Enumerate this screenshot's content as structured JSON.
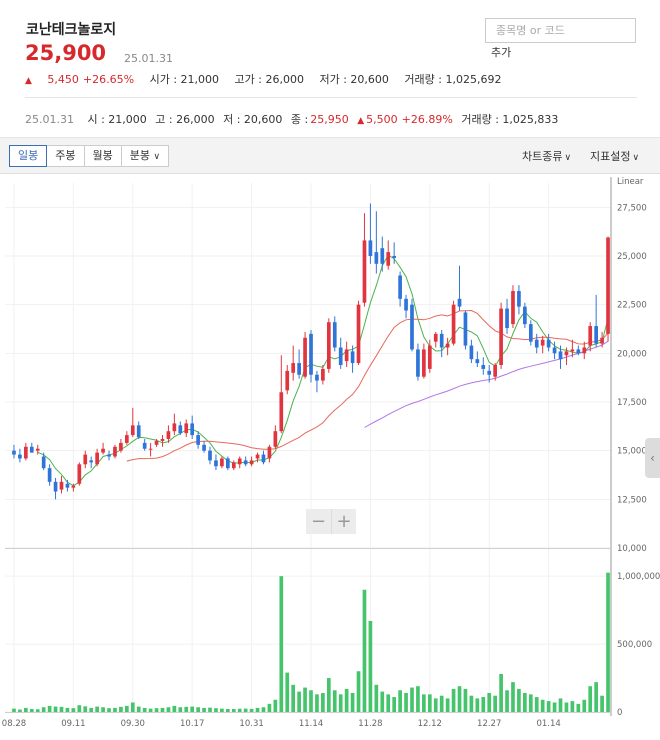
{
  "stock": {
    "name": "코난테크놀로지",
    "price": "25,900",
    "date": "25.01.31",
    "change_arrow": "▲",
    "change": "5,450",
    "change_pct": "+26.65%",
    "open_label": "시가 : 21,000",
    "high_label": "고가 : 26,000",
    "low_label": "저가 : 20,600",
    "volume_label": "거래량 : 1,025,692"
  },
  "search": {
    "placeholder": "종목명 or 코드",
    "add_label": "추가"
  },
  "ohlc_bar": {
    "date": "25.01.31",
    "open": "시 : 21,000",
    "high": "고 : 26,000",
    "low": "저 : 20,600",
    "close_label": "종 :",
    "close": "25,950",
    "change_arrow": "▲",
    "change": "5,500",
    "change_pct": "+26.89%",
    "volume": "거래량 : 1,025,833"
  },
  "toolbar": {
    "tabs": [
      "일봉",
      "주봉",
      "월봉",
      "분봉"
    ],
    "minute_chevron": "∨",
    "chart_type": "차트종류",
    "indicator": "지표설정",
    "chevron": "∨"
  },
  "zoom": {
    "minus": "−",
    "plus": "+"
  },
  "side_handle": "‹",
  "colors": {
    "up": "#e0353f",
    "down": "#2f74d8",
    "ma5": "#4cb34c",
    "ma20": "#e8695b",
    "ma60": "#b277e8",
    "ma120": "#f0a25a",
    "volume": "#46c46c"
  },
  "chart_data": {
    "type": "candlestick",
    "price_scale_label": "Linear",
    "ylim": [
      10000,
      28750
    ],
    "y_ticks": [
      "27,500",
      "25,000",
      "22,500",
      "20,000",
      "17,500",
      "15,000",
      "12,500",
      "10,000"
    ],
    "y_tick_values": [
      27500,
      25000,
      22500,
      20000,
      17500,
      15000,
      12500,
      10000
    ],
    "x_ticks": [
      "08.28",
      "09.11",
      "09.30",
      "10.17",
      "10.31",
      "11.14",
      "11.28",
      "12.12",
      "12.27",
      "01.14"
    ],
    "x_tick_index": [
      0,
      10,
      20,
      30,
      40,
      50,
      60,
      70,
      80,
      90
    ],
    "volume_ticks": [
      "1,000,000",
      "500,000",
      "0"
    ],
    "volume_tick_values": [
      1000000,
      500000,
      0
    ],
    "volume_max": 1200000,
    "candles": [
      {
        "o": 15000,
        "h": 15300,
        "l": 14600,
        "c": 14800,
        "v": 25000
      },
      {
        "o": 14800,
        "h": 15100,
        "l": 14400,
        "c": 14600,
        "v": 18000
      },
      {
        "o": 14600,
        "h": 15400,
        "l": 14500,
        "c": 15200,
        "v": 30000
      },
      {
        "o": 15200,
        "h": 15400,
        "l": 14900,
        "c": 14900,
        "v": 22000
      },
      {
        "o": 15000,
        "h": 15300,
        "l": 14800,
        "c": 15100,
        "v": 20000
      },
      {
        "o": 14700,
        "h": 14900,
        "l": 14000,
        "c": 14100,
        "v": 35000
      },
      {
        "o": 14100,
        "h": 14300,
        "l": 13200,
        "c": 13400,
        "v": 45000
      },
      {
        "o": 13400,
        "h": 13600,
        "l": 12500,
        "c": 12900,
        "v": 40000
      },
      {
        "o": 13000,
        "h": 13700,
        "l": 12800,
        "c": 13400,
        "v": 38000
      },
      {
        "o": 13300,
        "h": 13500,
        "l": 12900,
        "c": 13100,
        "v": 30000
      },
      {
        "o": 13100,
        "h": 13300,
        "l": 12900,
        "c": 13200,
        "v": 28000
      },
      {
        "o": 13300,
        "h": 14400,
        "l": 13200,
        "c": 14300,
        "v": 50000
      },
      {
        "o": 14300,
        "h": 15000,
        "l": 14100,
        "c": 14800,
        "v": 42000
      },
      {
        "o": 14500,
        "h": 14700,
        "l": 14100,
        "c": 14400,
        "v": 30000
      },
      {
        "o": 14300,
        "h": 15100,
        "l": 14200,
        "c": 14900,
        "v": 40000
      },
      {
        "o": 14900,
        "h": 15400,
        "l": 14800,
        "c": 15100,
        "v": 35000
      },
      {
        "o": 14800,
        "h": 15000,
        "l": 14500,
        "c": 14700,
        "v": 28000
      },
      {
        "o": 14700,
        "h": 15300,
        "l": 14600,
        "c": 15200,
        "v": 30000
      },
      {
        "o": 15000,
        "h": 15600,
        "l": 14900,
        "c": 15400,
        "v": 38000
      },
      {
        "o": 15400,
        "h": 16000,
        "l": 15300,
        "c": 15800,
        "v": 45000
      },
      {
        "o": 15800,
        "h": 17200,
        "l": 15700,
        "c": 16300,
        "v": 70000
      },
      {
        "o": 16300,
        "h": 16500,
        "l": 15600,
        "c": 15700,
        "v": 40000
      },
      {
        "o": 15400,
        "h": 15600,
        "l": 15000,
        "c": 15100,
        "v": 30000
      },
      {
        "o": 15100,
        "h": 15400,
        "l": 14700,
        "c": 15100,
        "v": 25000
      },
      {
        "o": 15300,
        "h": 15600,
        "l": 15200,
        "c": 15500,
        "v": 28000
      },
      {
        "o": 15500,
        "h": 15800,
        "l": 15200,
        "c": 15600,
        "v": 30000
      },
      {
        "o": 15600,
        "h": 16300,
        "l": 15400,
        "c": 16000,
        "v": 35000
      },
      {
        "o": 16000,
        "h": 16900,
        "l": 15800,
        "c": 16400,
        "v": 45000
      },
      {
        "o": 16300,
        "h": 16500,
        "l": 15800,
        "c": 15900,
        "v": 35000
      },
      {
        "o": 15900,
        "h": 16600,
        "l": 15700,
        "c": 16400,
        "v": 38000
      },
      {
        "o": 16400,
        "h": 16800,
        "l": 15600,
        "c": 15800,
        "v": 40000
      },
      {
        "o": 15800,
        "h": 16000,
        "l": 15100,
        "c": 15300,
        "v": 35000
      },
      {
        "o": 15300,
        "h": 15500,
        "l": 14900,
        "c": 15000,
        "v": 30000
      },
      {
        "o": 15000,
        "h": 15200,
        "l": 14300,
        "c": 14500,
        "v": 32000
      },
      {
        "o": 14500,
        "h": 14800,
        "l": 14000,
        "c": 14200,
        "v": 28000
      },
      {
        "o": 14200,
        "h": 14700,
        "l": 14100,
        "c": 14600,
        "v": 25000
      },
      {
        "o": 14600,
        "h": 14700,
        "l": 14000,
        "c": 14100,
        "v": 22000
      },
      {
        "o": 14100,
        "h": 14500,
        "l": 14000,
        "c": 14400,
        "v": 22000
      },
      {
        "o": 14300,
        "h": 14700,
        "l": 14100,
        "c": 14600,
        "v": 24000
      },
      {
        "o": 14500,
        "h": 14700,
        "l": 14200,
        "c": 14300,
        "v": 25000
      },
      {
        "o": 14300,
        "h": 14700,
        "l": 14200,
        "c": 14500,
        "v": 23000
      },
      {
        "o": 14600,
        "h": 14900,
        "l": 14400,
        "c": 14800,
        "v": 30000
      },
      {
        "o": 14800,
        "h": 15000,
        "l": 14300,
        "c": 14400,
        "v": 35000
      },
      {
        "o": 14600,
        "h": 15300,
        "l": 14400,
        "c": 15200,
        "v": 60000
      },
      {
        "o": 15200,
        "h": 16300,
        "l": 15100,
        "c": 16000,
        "v": 90000
      },
      {
        "o": 16000,
        "h": 19900,
        "l": 15900,
        "c": 18000,
        "v": 1000000
      },
      {
        "o": 18100,
        "h": 19400,
        "l": 17900,
        "c": 19100,
        "v": 290000
      },
      {
        "o": 19000,
        "h": 20400,
        "l": 18600,
        "c": 19500,
        "v": 200000
      },
      {
        "o": 19500,
        "h": 20200,
        "l": 18700,
        "c": 18900,
        "v": 150000
      },
      {
        "o": 18800,
        "h": 21100,
        "l": 18700,
        "c": 20800,
        "v": 180000
      },
      {
        "o": 21000,
        "h": 21200,
        "l": 18500,
        "c": 18900,
        "v": 160000
      },
      {
        "o": 18900,
        "h": 19100,
        "l": 18000,
        "c": 18600,
        "v": 130000
      },
      {
        "o": 18600,
        "h": 19400,
        "l": 18400,
        "c": 19200,
        "v": 140000
      },
      {
        "o": 19200,
        "h": 21800,
        "l": 19000,
        "c": 21600,
        "v": 250000
      },
      {
        "o": 21600,
        "h": 21900,
        "l": 20100,
        "c": 20300,
        "v": 160000
      },
      {
        "o": 20300,
        "h": 20800,
        "l": 19200,
        "c": 19400,
        "v": 130000
      },
      {
        "o": 19600,
        "h": 20600,
        "l": 19300,
        "c": 20200,
        "v": 170000
      },
      {
        "o": 20100,
        "h": 20400,
        "l": 19000,
        "c": 19500,
        "v": 140000
      },
      {
        "o": 19500,
        "h": 22700,
        "l": 19400,
        "c": 22500,
        "v": 300000
      },
      {
        "o": 22600,
        "h": 27200,
        "l": 22400,
        "c": 25800,
        "v": 900000
      },
      {
        "o": 25800,
        "h": 27700,
        "l": 24600,
        "c": 25000,
        "v": 670000
      },
      {
        "o": 25200,
        "h": 27300,
        "l": 24100,
        "c": 24600,
        "v": 200000
      },
      {
        "o": 25400,
        "h": 26000,
        "l": 24200,
        "c": 24600,
        "v": 150000
      },
      {
        "o": 24500,
        "h": 25800,
        "l": 24300,
        "c": 25200,
        "v": 130000
      },
      {
        "o": 25000,
        "h": 25700,
        "l": 24600,
        "c": 24900,
        "v": 110000
      },
      {
        "o": 24000,
        "h": 24200,
        "l": 22400,
        "c": 22800,
        "v": 160000
      },
      {
        "o": 22800,
        "h": 23000,
        "l": 21800,
        "c": 22200,
        "v": 140000
      },
      {
        "o": 22500,
        "h": 22800,
        "l": 20100,
        "c": 20200,
        "v": 180000
      },
      {
        "o": 20200,
        "h": 20500,
        "l": 18600,
        "c": 18800,
        "v": 190000
      },
      {
        "o": 18800,
        "h": 20500,
        "l": 18700,
        "c": 20200,
        "v": 130000
      },
      {
        "o": 19200,
        "h": 20700,
        "l": 19000,
        "c": 20400,
        "v": 130000
      },
      {
        "o": 20600,
        "h": 21100,
        "l": 20300,
        "c": 21000,
        "v": 100000
      },
      {
        "o": 21000,
        "h": 21200,
        "l": 19800,
        "c": 20300,
        "v": 120000
      },
      {
        "o": 20300,
        "h": 20800,
        "l": 19900,
        "c": 20500,
        "v": 100000
      },
      {
        "o": 20500,
        "h": 22700,
        "l": 20400,
        "c": 22500,
        "v": 170000
      },
      {
        "o": 22800,
        "h": 24500,
        "l": 22200,
        "c": 22400,
        "v": 190000
      },
      {
        "o": 22100,
        "h": 22200,
        "l": 20200,
        "c": 20400,
        "v": 170000
      },
      {
        "o": 20400,
        "h": 20700,
        "l": 19500,
        "c": 19700,
        "v": 120000
      },
      {
        "o": 19700,
        "h": 20100,
        "l": 19300,
        "c": 19500,
        "v": 100000
      },
      {
        "o": 19400,
        "h": 19800,
        "l": 18900,
        "c": 19200,
        "v": 110000
      },
      {
        "o": 19100,
        "h": 19400,
        "l": 18500,
        "c": 18900,
        "v": 140000
      },
      {
        "o": 18800,
        "h": 19500,
        "l": 18600,
        "c": 19400,
        "v": 120000
      },
      {
        "o": 19400,
        "h": 22600,
        "l": 19200,
        "c": 22300,
        "v": 280000
      },
      {
        "o": 22300,
        "h": 22800,
        "l": 21000,
        "c": 21300,
        "v": 160000
      },
      {
        "o": 21500,
        "h": 23500,
        "l": 21300,
        "c": 23200,
        "v": 220000
      },
      {
        "o": 23200,
        "h": 23500,
        "l": 22000,
        "c": 22400,
        "v": 170000
      },
      {
        "o": 22400,
        "h": 22600,
        "l": 21300,
        "c": 21500,
        "v": 140000
      },
      {
        "o": 21500,
        "h": 21700,
        "l": 20400,
        "c": 20600,
        "v": 130000
      },
      {
        "o": 20700,
        "h": 21000,
        "l": 20000,
        "c": 20300,
        "v": 110000
      },
      {
        "o": 20400,
        "h": 20900,
        "l": 20000,
        "c": 20700,
        "v": 90000
      },
      {
        "o": 20700,
        "h": 21000,
        "l": 20100,
        "c": 20300,
        "v": 80000
      },
      {
        "o": 20300,
        "h": 20600,
        "l": 19700,
        "c": 20000,
        "v": 70000
      },
      {
        "o": 20100,
        "h": 20400,
        "l": 19200,
        "c": 19700,
        "v": 100000
      },
      {
        "o": 19900,
        "h": 20300,
        "l": 19400,
        "c": 20100,
        "v": 70000
      },
      {
        "o": 20100,
        "h": 20700,
        "l": 19800,
        "c": 20200,
        "v": 80000
      },
      {
        "o": 20200,
        "h": 20400,
        "l": 19900,
        "c": 20000,
        "v": 60000
      },
      {
        "o": 20000,
        "h": 20600,
        "l": 19700,
        "c": 20300,
        "v": 90000
      },
      {
        "o": 20400,
        "h": 21600,
        "l": 20100,
        "c": 21400,
        "v": 190000
      },
      {
        "o": 21400,
        "h": 23000,
        "l": 20300,
        "c": 20500,
        "v": 220000
      },
      {
        "o": 20500,
        "h": 21100,
        "l": 20300,
        "c": 20800,
        "v": 120000
      },
      {
        "o": 21000,
        "h": 26000,
        "l": 20600,
        "c": 25950,
        "v": 1025833
      }
    ],
    "moving_averages": [
      {
        "period": 5,
        "color": "#4cb34c"
      },
      {
        "period": 20,
        "color": "#e8695b"
      },
      {
        "period": 60,
        "color": "#b277e8"
      },
      {
        "period": 120,
        "color": "#f0a25a"
      }
    ]
  }
}
